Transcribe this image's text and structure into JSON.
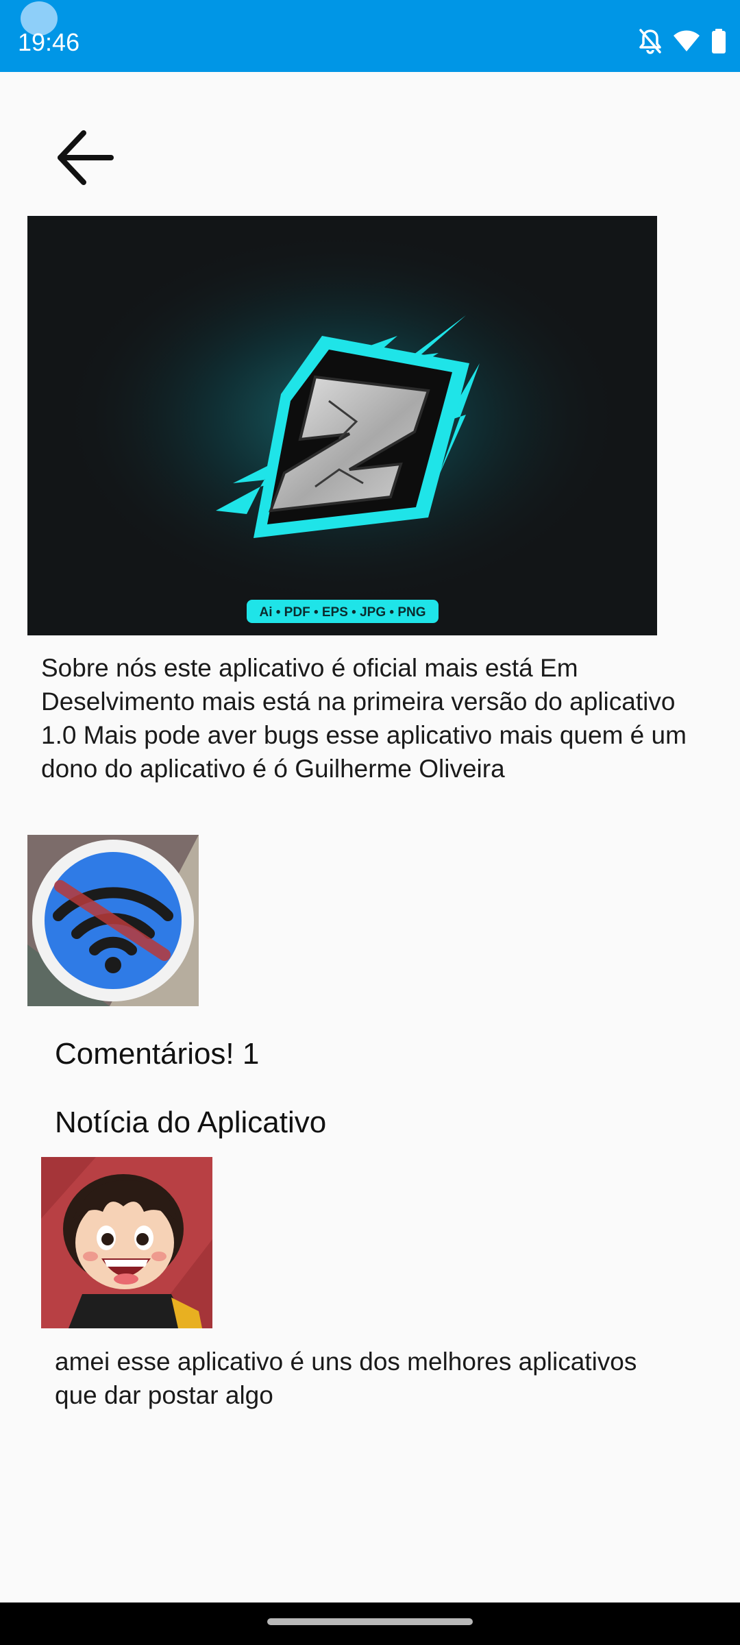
{
  "status_bar": {
    "time": "19:46",
    "background_color": "#0096e6",
    "icons": [
      "bell-off-icon",
      "wifi-icon",
      "battery-icon"
    ]
  },
  "header": {
    "back_icon": "arrow-left-icon"
  },
  "hero": {
    "logo_letter": "Z",
    "badge_text": "Ai • PDF • EPS • JPG • PNG",
    "accent_color": "#1fe4e8"
  },
  "about": {
    "text": "Sobre nós este aplicativo é oficial mais está Em Deselvimento mais está na primeira versão do aplicativo 1.0 Mais pode aver bugs esse aplicativo mais quem é um dono do aplicativo é ó Guilherme Oliveira"
  },
  "wifi_image": {
    "icon": "wifi-off-icon",
    "color": "#2f7be6"
  },
  "comments": {
    "heading": "Comentários! 1"
  },
  "news": {
    "heading": "Notícia do Aplicativo"
  },
  "comment": {
    "avatar": "cartoon-avatar",
    "text": "amei esse aplicativo é uns dos melhores aplicativos que dar postar algo"
  }
}
